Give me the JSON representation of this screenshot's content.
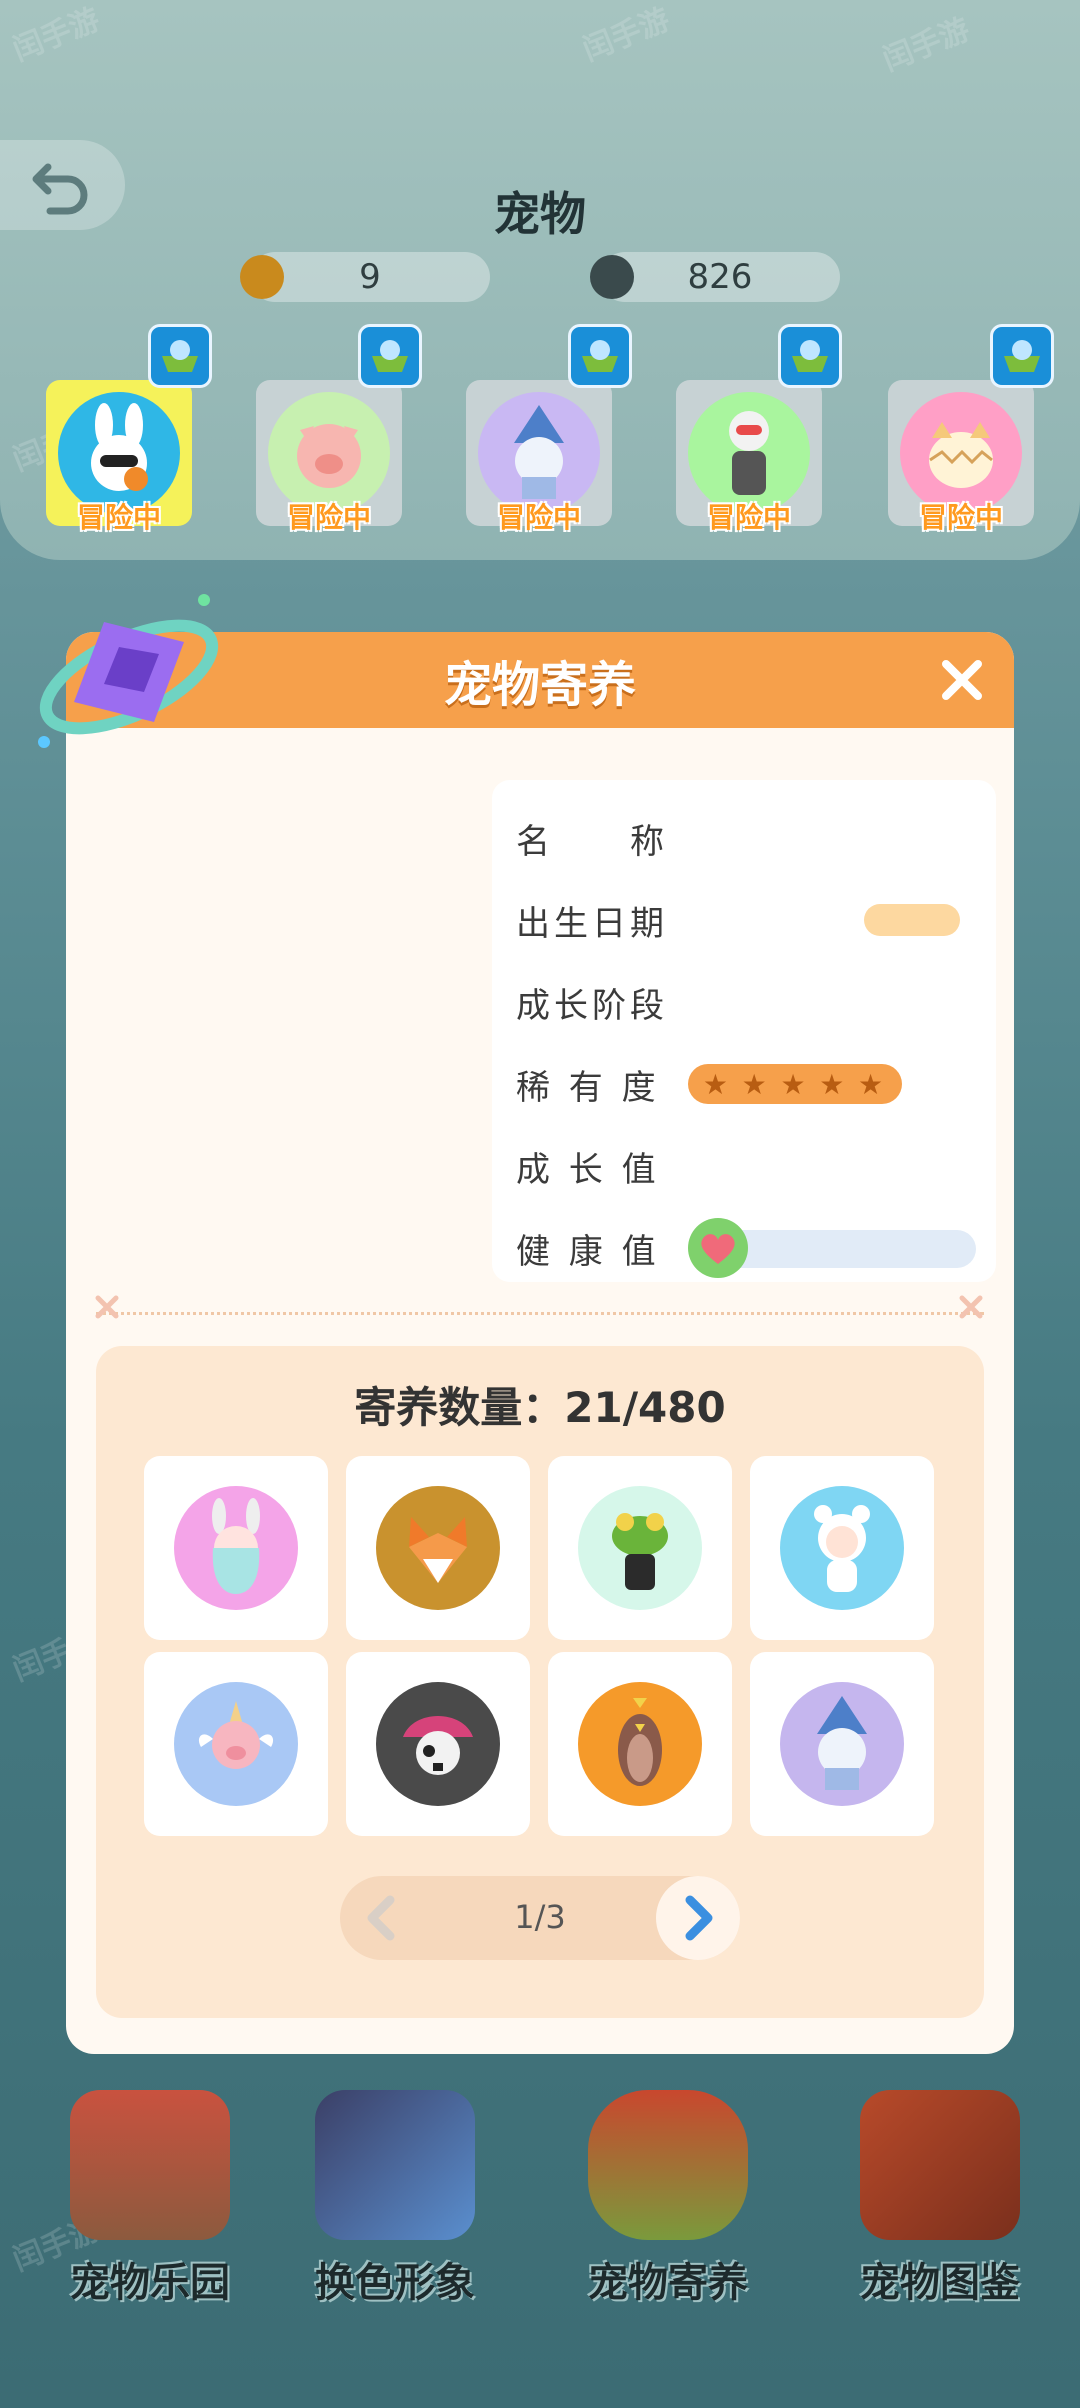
{
  "header": {
    "title": "宠物",
    "coins": "9",
    "gems": "826"
  },
  "adventure_pets": [
    {
      "status": "冒险中",
      "ring": "#2fb7e6",
      "active": true
    },
    {
      "status": "冒险中",
      "ring": "#c7f0b0",
      "active": false
    },
    {
      "status": "冒险中",
      "ring": "#c9b8f3",
      "active": false
    },
    {
      "status": "冒险中",
      "ring": "#a9f59e",
      "active": false
    },
    {
      "status": "冒险中",
      "ring": "#ff9fc6",
      "active": false
    }
  ],
  "modal": {
    "title": "宠物寄养",
    "info": {
      "name_label": "名　　称",
      "birthday_label": "出生日期",
      "stage_label": "成长阶段",
      "rarity_label": "稀 有 度",
      "rarity_stars": 5,
      "growth_label": "成 长 值",
      "health_label": "健 康 值"
    },
    "foster": {
      "count_text": "寄养数量：21/480",
      "pets": [
        {
          "icon": "bunny-girl-pet-icon",
          "ring": "#f4a4e8"
        },
        {
          "icon": "fox-pet-icon",
          "ring": "#c9922e"
        },
        {
          "icon": "frog-pet-icon",
          "ring": "#d6f7ea"
        },
        {
          "icon": "bear-girl-pet-icon",
          "ring": "#7fd6f3"
        },
        {
          "icon": "winged-pig-pet-icon",
          "ring": "#a9c8f5"
        },
        {
          "icon": "pirate-pet-icon",
          "ring": "#4a4a4a"
        },
        {
          "icon": "penguin-pet-icon",
          "ring": "#f59a2a"
        },
        {
          "icon": "witch-girl-pet-icon",
          "ring": "#c5b6ee"
        }
      ],
      "page": "1/3"
    }
  },
  "bottom_nav": [
    {
      "label": "宠物乐园",
      "icon": "pet-park-icon"
    },
    {
      "label": "换色形象",
      "icon": "color-change-icon"
    },
    {
      "label": "宠物寄养",
      "icon": "pet-foster-icon"
    },
    {
      "label": "宠物图鉴",
      "icon": "pet-handbook-icon"
    }
  ]
}
